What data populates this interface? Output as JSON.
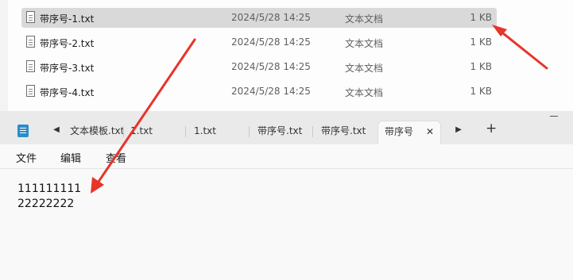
{
  "explorer": {
    "files": [
      {
        "name": "带序号-1.txt",
        "date": "2024/5/28 14:25",
        "type": "文本文档",
        "size": "1 KB",
        "selected": true
      },
      {
        "name": "带序号-2.txt",
        "date": "2024/5/28 14:25",
        "type": "文本文档",
        "size": "1 KB",
        "selected": false
      },
      {
        "name": "带序号-3.txt",
        "date": "2024/5/28 14:25",
        "type": "文本文档",
        "size": "1 KB",
        "selected": false
      },
      {
        "name": "带序号-4.txt",
        "date": "2024/5/28 14:25",
        "type": "文本文档",
        "size": "1 KB",
        "selected": false
      }
    ]
  },
  "notepad": {
    "tabs": [
      {
        "label": "文本模板.txt",
        "active": false
      },
      {
        "label": "1.txt",
        "active": false
      },
      {
        "label": "1.txt",
        "active": false
      },
      {
        "label": "带序号.txt",
        "active": false
      },
      {
        "label": "带序号.txt",
        "active": false
      },
      {
        "label": "带序号",
        "active": true
      }
    ],
    "close_glyph": "✕",
    "new_tab_glyph": "+",
    "scroll_left_glyph": "◀",
    "scroll_right_glyph": "▶",
    "menu": {
      "file": "文件",
      "edit": "编辑",
      "view": "查看"
    },
    "content": [
      "111111111",
      "22222222"
    ]
  },
  "colors": {
    "arrow": "#e8342a",
    "selected_row": "#d9d9d9",
    "app_icon": "#2a8ec9"
  }
}
